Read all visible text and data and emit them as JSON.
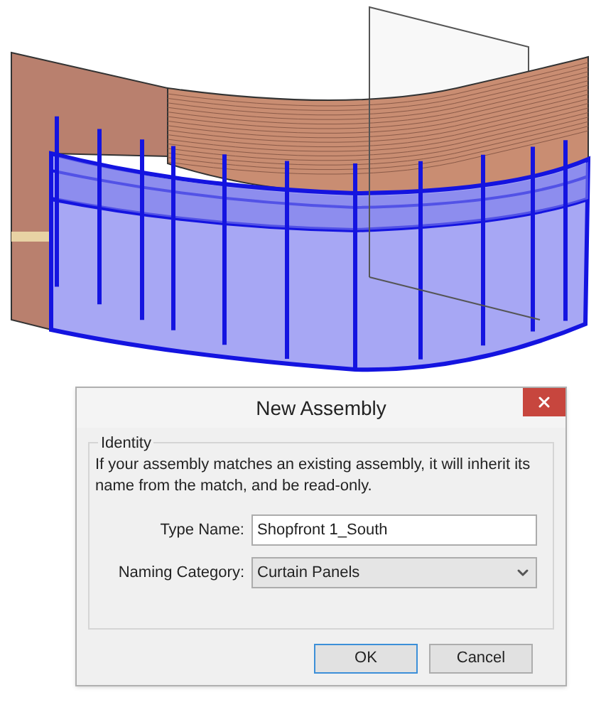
{
  "dialog": {
    "title": "New Assembly",
    "group": {
      "label": "Identity",
      "description": "If your assembly matches an existing assembly, it will inherit its name from the match, and be read-only."
    },
    "fields": [
      {
        "kind": "text",
        "label": "Type Name:",
        "value": "Shopfront 1_South"
      },
      {
        "kind": "select",
        "label": "Naming Category:",
        "value": "Curtain Panels"
      }
    ],
    "buttons": [
      {
        "label": "OK",
        "default": true
      },
      {
        "label": "Cancel",
        "default": false
      }
    ]
  }
}
